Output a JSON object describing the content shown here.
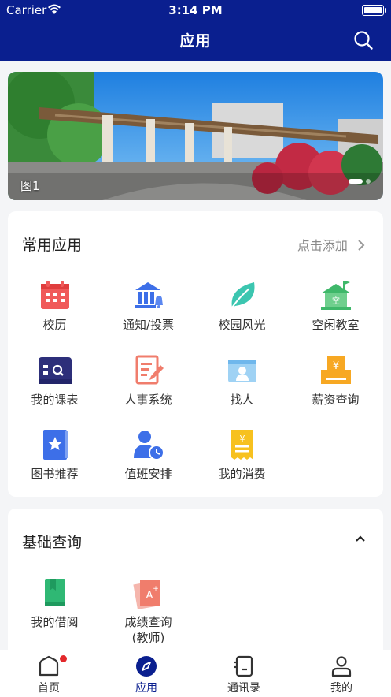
{
  "status_bar": {
    "carrier": "Carrier",
    "time": "3:14 PM",
    "battery_level": 1.0
  },
  "header": {
    "title": "应用",
    "search_icon": "search-icon"
  },
  "banner": {
    "caption": "图1",
    "page_count": 2,
    "active_page": 1
  },
  "common_apps": {
    "title": "常用应用",
    "action_label": "点击添加",
    "apps": [
      {
        "label": "校历",
        "icon": "calendar-icon",
        "color": "#f05a5a"
      },
      {
        "label": "通知/投票",
        "icon": "notice-icon",
        "color": "#3d6fe8"
      },
      {
        "label": "校园风光",
        "icon": "leaf-icon",
        "color": "#3cc6b0"
      },
      {
        "label": "空闲教室",
        "icon": "classroom-icon",
        "color": "#3fb86a"
      },
      {
        "label": "我的课表",
        "icon": "timetable-icon",
        "color": "#2d2f7a"
      },
      {
        "label": "人事系统",
        "icon": "hr-icon",
        "color": "#f07d6c"
      },
      {
        "label": "找人",
        "icon": "find-person-icon",
        "color": "#6fb7ec"
      },
      {
        "label": "薪资查询",
        "icon": "salary-icon",
        "color": "#f7a823"
      },
      {
        "label": "图书推荐",
        "icon": "book-star-icon",
        "color": "#3d6fe8"
      },
      {
        "label": "值班安排",
        "icon": "duty-icon",
        "color": "#3d6fe8"
      },
      {
        "label": "我的消费",
        "icon": "receipt-icon",
        "color": "#f7c11f"
      }
    ]
  },
  "basic_query": {
    "title": "基础查询",
    "collapse_icon": "chevron-up-icon",
    "apps": [
      {
        "label": "我的借阅",
        "icon": "borrow-book-icon",
        "color": "#2fb874"
      },
      {
        "label": "成绩查询\n(教师)",
        "label_line1": "成绩查询",
        "label_line2": "(教师)",
        "icon": "grade-icon",
        "color": "#f07d6c"
      }
    ]
  },
  "tabbar": {
    "tabs": [
      {
        "label": "首页",
        "icon": "home-icon",
        "badge": true
      },
      {
        "label": "应用",
        "icon": "compass-icon",
        "active": true
      },
      {
        "label": "通讯录",
        "icon": "contacts-icon"
      },
      {
        "label": "我的",
        "icon": "person-icon"
      }
    ]
  },
  "colors": {
    "primary": "#0a1f8f",
    "badge": "#e3282b"
  }
}
